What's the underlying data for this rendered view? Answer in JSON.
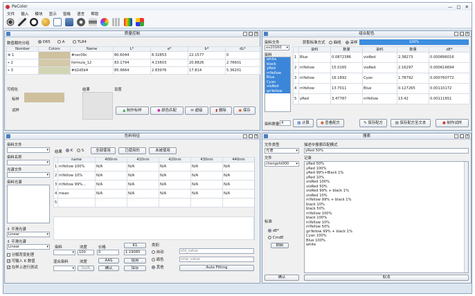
{
  "app": {
    "title": "PeColor",
    "window_controls": [
      "—",
      "□",
      "✕"
    ]
  },
  "menu": [
    "文件",
    "输入",
    "模块",
    "显示",
    "窗格",
    "语言",
    "帮助"
  ],
  "toolbar": {
    "icons": [
      "target-icon",
      "pen-icon",
      "circle-icon",
      "sphere-icon",
      "document-icon",
      "database-icon",
      "gear-icon",
      "printer-icon",
      "palette-icon",
      "grid-icon",
      "spectrum-icon",
      "swatch-icon"
    ]
  },
  "quality": {
    "title": "质量控制",
    "source_label": "数值载的分组",
    "options": [
      "D65",
      "A",
      "TL84"
    ],
    "headers": [
      "Number",
      "Colors",
      "Name",
      "L*",
      "a*",
      "b*",
      "dL*"
    ],
    "rows": [
      {
        "num": "1",
        "name": "#cec09c",
        "L": "80.6044",
        "a": "8.32853",
        "b": "22.1577",
        "dL": "0",
        "color": "#cfc29f"
      },
      {
        "num": "2",
        "name": "formula_12",
        "L": "83.1794",
        "a": "4.15603",
        "b": "20.8826",
        "dL": "2.76601",
        "dL2": "-4.171",
        "color": "#d4c9a8"
      },
      {
        "num": "3",
        "name": "#d2d5b4",
        "L": "85.9664",
        "a": "2.83976",
        "b": "17.814",
        "dL": "5.36201",
        "dL2": "-5.468",
        "color": "#d2d5b4"
      }
    ],
    "viz_label": "可视化",
    "std_label": "标样",
    "trial_label": "试样",
    "result_label": "结果",
    "settings_label": "设置",
    "buttons": [
      "制作标样",
      "颜色匹配",
      "超级",
      "删除",
      "保存"
    ]
  },
  "match": {
    "title": "组合配色",
    "file_label": "染料文件",
    "file_value": "xx20160",
    "mode_label": "获取标准方式",
    "modes": [
      "曲线",
      "采样"
    ],
    "progress": "100%",
    "dye_label": "染料",
    "dyes": [
      "white",
      "black",
      "yRed",
      "mYellow",
      "Blue",
      "Cyan",
      "vioRed",
      "gnYellow"
    ],
    "headers": [
      "",
      "染料",
      "数量",
      "染料",
      "数量",
      "dE*"
    ],
    "rows": [
      [
        "1",
        "Blue",
        "0.0872386",
        "vioRed",
        "2.38273",
        "0.000896016"
      ],
      [
        "2",
        "mYellow",
        "15.0165",
        "vioRed",
        "2.16297",
        "0.000616694"
      ],
      [
        "3",
        "mYellow",
        "16.1892",
        "Cyan",
        "1.78792",
        "0.000760772"
      ],
      [
        "4",
        "mYellow",
        "13.7011",
        "Blue",
        "0.127265",
        "0.00110172"
      ],
      [
        "5",
        "yRed",
        "3.47787",
        "mYellow",
        "13.42",
        "0.00111651"
      ]
    ],
    "qty_label": "染料数量",
    "qty_value": "4",
    "buttons": [
      "计算",
      "查看配方",
      "保存配方",
      "保存配方至文本",
      "制作试样"
    ]
  },
  "feature": {
    "title": "色料特征",
    "dye_file_label": "染料文件",
    "dye_name_label": "染料名称",
    "light_file_label": "光谱文件",
    "dye_spec_label": "染料光谱",
    "plane_label": "平滑光谱",
    "plane_value": "Linear",
    "plane2_label": "平滑光谱",
    "plane2_value": "Linear",
    "checks": [
      "分解背景处理",
      "可输入 K 数值",
      "在样上进行测试"
    ],
    "result_label": "结果",
    "result_opts": [
      "K",
      "S"
    ],
    "buttons_top": [
      "全部使用",
      "已使用的",
      "未被使用"
    ],
    "headers": [
      "",
      "name",
      "400nm",
      "410nm",
      "420nm",
      "430nm",
      "440nm"
    ],
    "rows": [
      [
        "1",
        "mYellow 100%",
        "N/A",
        "N/A",
        "N/A",
        "N/A",
        "N/A"
      ],
      [
        "2",
        "mYellow 10%",
        "N/A",
        "N/A",
        "N/A",
        "N/A",
        "N/A"
      ],
      [
        "3",
        "mYellow 99%...",
        "N/A",
        "N/A",
        "N/A",
        "N/A",
        "N/A"
      ],
      [
        "4",
        "mean",
        "N/A",
        "N/A",
        "N/A",
        "N/A",
        "N/A"
      ],
      [
        "5",
        "",
        "",
        "",
        "",
        "",
        ""
      ]
    ],
    "bottom": {
      "dye_label": "染料",
      "conc_label": "浓度",
      "price_label": "价格",
      "k_label": "K1",
      "conc_value": "100",
      "price_value": "0",
      "k_value": "1.19085",
      "mix_label": "混合染料",
      "conc2_label": "浓度",
      "abs_label": "AAS",
      "use_label": "使用",
      "category_label": "类别",
      "cats": [
        "自动",
        "面色",
        "其他"
      ],
      "btns": [
        "确认",
        "删除",
        "保存",
        "SetK"
      ],
      "fields": [
        "std_value",
        "smp_value"
      ],
      "auto_btn": "Auto Fitting"
    }
  },
  "search": {
    "title": "搜索",
    "type_label": "文件类型",
    "type_value": "光谱",
    "desc_label": "描述中搜索匹配模式",
    "desc_value": "yRed 50%",
    "file_label": "文件",
    "file_value": "chongshi000",
    "record_label": "记录",
    "records": [
      "yRed 50%",
      "yRed 100%",
      "yRed 99%+Black 1%",
      "yRed 10%",
      "vioRed 100%",
      "vioRed 50%",
      "vioRed 99% + black 1%",
      "vioRed 10%",
      "mYellow 99% + black 1%",
      "black 10%",
      "black 50%",
      "mYellow 100%",
      "black 100%",
      "mYellow 10%",
      "mYellow 50%",
      "gnYellow 99% + black 1%",
      "Cyan 100%",
      "Blue 100%",
      "white"
    ],
    "std_label": "标准",
    "std_opts": [
      "dE*",
      "CmdE"
    ],
    "refresh_btn": "刷新",
    "ok_btn": "确认",
    "cancel_btn": "取消"
  }
}
